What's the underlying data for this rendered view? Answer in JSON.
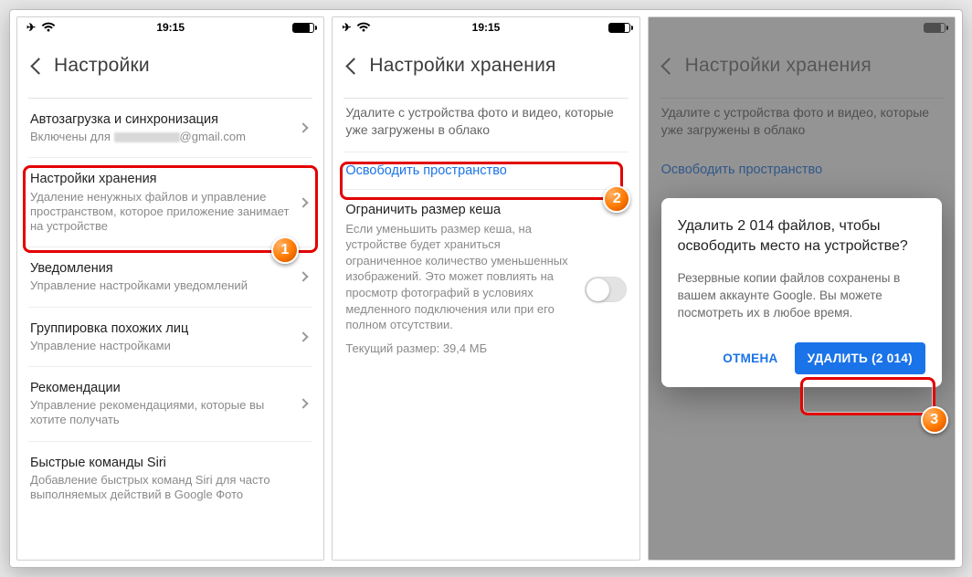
{
  "status_time": "19:15",
  "screens": {
    "s1": {
      "title": "Настройки",
      "rows": {
        "autosync": {
          "title": "Автозагрузка и синхронизация",
          "sub_prefix": "Включены для ",
          "sub_suffix": "@gmail.com"
        },
        "storage": {
          "title": "Настройки хранения",
          "sub": "Удаление ненужных файлов и управление пространством, которое приложение занимает на устройстве"
        },
        "notif": {
          "title": "Уведомления",
          "sub": "Управление настройками уведомлений"
        },
        "faces": {
          "title": "Группировка похожих лиц",
          "sub": "Управление настройками"
        },
        "recs": {
          "title": "Рекомендации",
          "sub": "Управление рекомендациями, которые вы хотите получать"
        },
        "siri": {
          "title": "Быстрые команды Siri",
          "sub": "Добавление быстрых команд Siri для часто выполняемых действий в Google Фото"
        }
      },
      "badge": "1"
    },
    "s2": {
      "title": "Настройки хранения",
      "intro": "Удалите с устройства фото и видео, которые уже загружены в облако",
      "free_up": "Освободить пространство",
      "cache_title": "Ограничить размер кеша",
      "cache_desc": "Если уменьшить размер кеша, на устройстве будет храниться ограниченное количество уменьшенных изображений. Это может повлиять на просмотр фотографий в условиях медленного подключения или при его полном отсутствии.",
      "cache_current": "Текущий размер: 39,4 МБ",
      "badge": "2"
    },
    "s3": {
      "title": "Настройки хранения",
      "intro": "Удалите с устройства фото и видео, которые уже загружены в облако",
      "ghost_link": "Освободить пространство",
      "dialog": {
        "heading": "Удалить 2 014 файлов, чтобы освободить место на устройстве?",
        "body": "Резервные копии файлов сохранены в вашем аккаунте Google. Вы можете посмотреть их в любое время.",
        "cancel": "ОТМЕНА",
        "confirm": "УДАЛИТЬ (2 014)"
      },
      "badge": "3"
    }
  }
}
